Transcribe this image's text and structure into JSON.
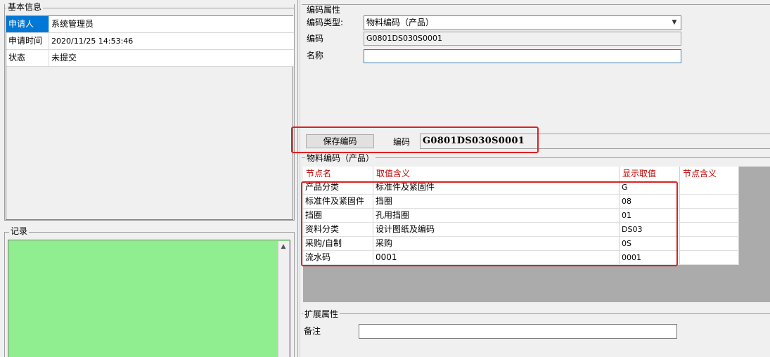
{
  "left": {
    "info_title": "基本信息",
    "info_rows": [
      {
        "key": "申请人",
        "value": "系统管理员"
      },
      {
        "key": "申请时间",
        "value": "2020/11/25 14:53:46"
      },
      {
        "key": "状态",
        "value": "未提交"
      }
    ],
    "records_title": "记录",
    "records_scroll_up": "▲"
  },
  "right": {
    "code_prop_title": "编码属性",
    "code_type_label": "编码类型:",
    "code_type_value": "物料编码（产品）",
    "code_type_arrow": "▼",
    "code_label": "编码",
    "code_value": "G0801DS030S0001",
    "name_label": "名称",
    "name_value": "",
    "save_button": "保存编码",
    "code_label2": "编码",
    "code_display": "G0801DS030S0001",
    "grid_title": "物料编码（产品）",
    "grid_headers": [
      "节点名",
      "取值含义",
      "显示取值",
      "节点含义"
    ],
    "grid_rows": [
      {
        "node": "产品分类",
        "meaning": "标准件及紧固件",
        "display": "G",
        "node_meaning": ""
      },
      {
        "node": "标准件及紧固件",
        "meaning": "挡圈",
        "display": "08",
        "node_meaning": ""
      },
      {
        "node": "挡圈",
        "meaning": "孔用挡圈",
        "display": "01",
        "node_meaning": ""
      },
      {
        "node": "资料分类",
        "meaning": "设计图纸及编码",
        "display": "DS03",
        "node_meaning": ""
      },
      {
        "node": "采购/自制",
        "meaning": "采购",
        "display": "0S",
        "node_meaning": ""
      },
      {
        "node": "流水码",
        "meaning": "0001",
        "display": "0001",
        "node_meaning": ""
      }
    ],
    "ext_title": "扩展属性",
    "remark_label": "备注",
    "remark_value": ""
  },
  "colors": {
    "records_bg": "#90ee90",
    "selected_bg": "#0078d7",
    "header_text": "#c00000",
    "highlight_border": "#e02020"
  }
}
